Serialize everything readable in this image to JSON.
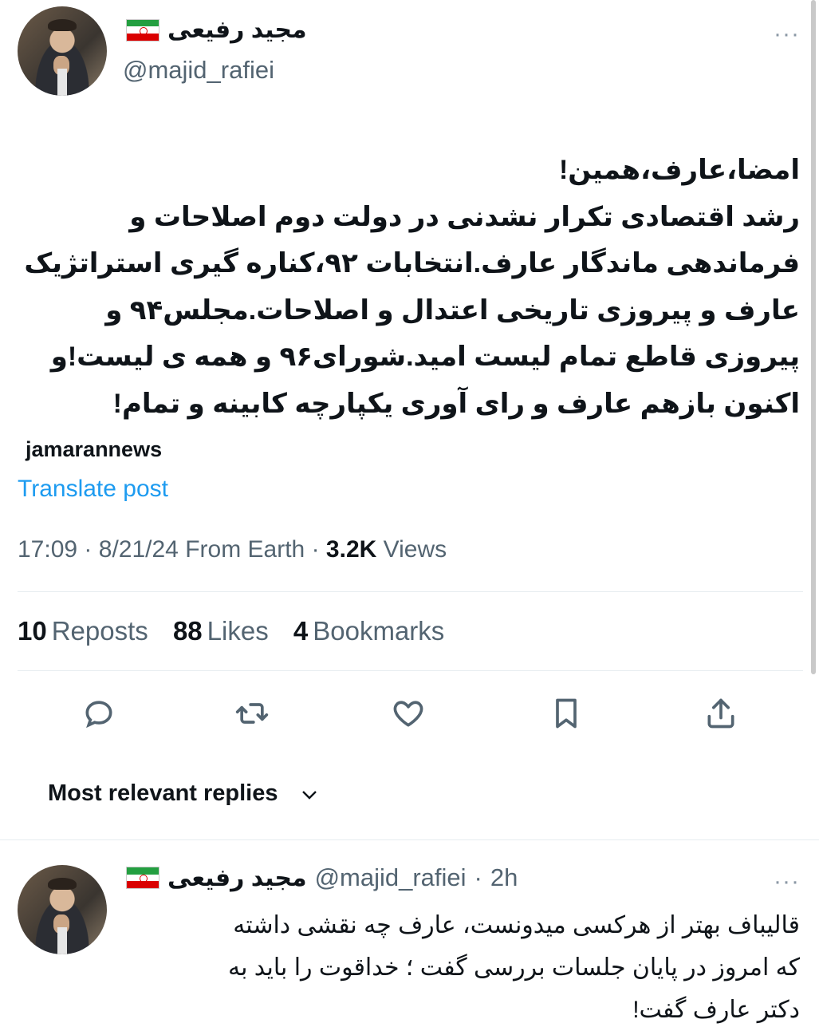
{
  "post": {
    "author_name": "مجید رفیعی",
    "author_handle": "@majid_rafiei",
    "more_label": "···",
    "text": "امضا،عارف،همین!\nرشد اقتصادی تکرار نشدنی در دولت دوم اصلاحات و\nفرماندهی ماندگار عارف.انتخابات ۹۲،کناره گیری استراتژیک\nعارف و پیروزی تاریخی اعتدال و اصلاحات.مجلس۹۴ و\nپیروزی قاطع تمام لیست امید.شورای۹۶ و همه ی لیست!و\nاکنون بازهم عارف و رای آوری یکپارچه کابینه و تمام!",
    "source": "jamarannews",
    "translate_label": "Translate post",
    "time": "17:09",
    "date": "8/21/24",
    "location": "From Earth",
    "views_count": "3.2K",
    "views_label": "Views"
  },
  "stats": {
    "reposts_count": "10",
    "reposts_label": "Reposts",
    "likes_count": "88",
    "likes_label": "Likes",
    "bookmarks_count": "4",
    "bookmarks_label": "Bookmarks"
  },
  "actions": [
    "reply-icon",
    "repost-icon",
    "like-icon",
    "bookmark-icon",
    "share-icon"
  ],
  "replies_sort": {
    "label": "Most relevant replies"
  },
  "reply": {
    "author_name": "مجید رفیعی",
    "author_handle": "@majid_rafiei",
    "age": "2h",
    "more_label": "···",
    "text": "قالیباف بهتر از هرکسی میدونست، عارف چه نقشی داشته\nکه امروز در پایان جلسات بررسی گفت ؛ خداقوت را باید به\nدکتر عارف گفت!"
  },
  "colors": {
    "link": "#1d9bf0",
    "secondary_text": "#536471",
    "divider": "#e6ecf0"
  }
}
